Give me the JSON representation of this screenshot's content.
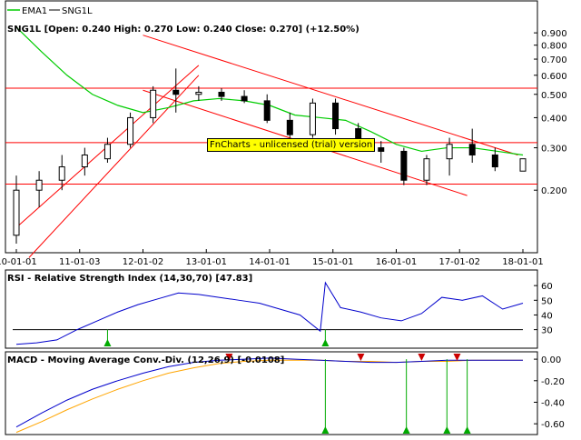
{
  "legend": {
    "ema_label": "EMA1",
    "sym_label": "SNG1L"
  },
  "price_panel": {
    "title": "SNG1L [Open: 0.240  High: 0.270  Low: 0.240  Close: 0.270] (+12.50%)"
  },
  "rsi_panel": {
    "title": "RSI - Relative Strength Index (14,30,70) [47.83]"
  },
  "macd_panel": {
    "title": "MACD - Moving Average Conv.-Div. (12,26,9) [-0.0108]"
  },
  "watermark": "FnCharts - unlicensed (trial) version",
  "colors": {
    "ema": "#00cc00",
    "rsi": "#0000cc",
    "macd": "#0000cc",
    "signal": "#ffa500",
    "trend": "#ff0000",
    "buy": "#00aa00",
    "sell": "#cc0000",
    "grid": "#000000",
    "bg": "#ffffff"
  },
  "chart_data": {
    "type": "candlestick",
    "x_ticks": [
      "10-01-01",
      "11-01-03",
      "12-01-02",
      "13-01-01",
      "14-01-01",
      "15-01-01",
      "16-01-01",
      "17-01-02",
      "18-01-01"
    ],
    "price": {
      "y_scale": "log",
      "ylim": [
        0.11,
        1.0
      ],
      "y_ticks": [
        "0.900",
        "0.800",
        "0.700",
        "0.600",
        "0.500",
        "0.400",
        "0.300",
        "0.200"
      ],
      "y_tick_values": [
        0.9,
        0.8,
        0.7,
        0.6,
        0.5,
        0.4,
        0.3,
        0.2
      ],
      "candles": [
        {
          "t": 0.0,
          "o": 0.13,
          "h": 0.23,
          "l": 0.12,
          "c": 0.2
        },
        {
          "t": 0.045,
          "o": 0.2,
          "h": 0.24,
          "l": 0.17,
          "c": 0.22
        },
        {
          "t": 0.09,
          "o": 0.22,
          "h": 0.28,
          "l": 0.2,
          "c": 0.25
        },
        {
          "t": 0.135,
          "o": 0.25,
          "h": 0.3,
          "l": 0.23,
          "c": 0.28
        },
        {
          "t": 0.18,
          "o": 0.27,
          "h": 0.33,
          "l": 0.26,
          "c": 0.31
        },
        {
          "t": 0.225,
          "o": 0.31,
          "h": 0.42,
          "l": 0.3,
          "c": 0.4
        },
        {
          "t": 0.27,
          "o": 0.4,
          "h": 0.54,
          "l": 0.38,
          "c": 0.52
        },
        {
          "t": 0.315,
          "o": 0.52,
          "h": 0.64,
          "l": 0.42,
          "c": 0.5
        },
        {
          "t": 0.36,
          "o": 0.5,
          "h": 0.54,
          "l": 0.47,
          "c": 0.51
        },
        {
          "t": 0.405,
          "o": 0.51,
          "h": 0.53,
          "l": 0.47,
          "c": 0.49
        },
        {
          "t": 0.45,
          "o": 0.49,
          "h": 0.52,
          "l": 0.46,
          "c": 0.47
        },
        {
          "t": 0.495,
          "o": 0.47,
          "h": 0.5,
          "l": 0.38,
          "c": 0.39
        },
        {
          "t": 0.54,
          "o": 0.39,
          "h": 0.42,
          "l": 0.33,
          "c": 0.34
        },
        {
          "t": 0.585,
          "o": 0.34,
          "h": 0.48,
          "l": 0.33,
          "c": 0.46
        },
        {
          "t": 0.63,
          "o": 0.46,
          "h": 0.48,
          "l": 0.34,
          "c": 0.36
        },
        {
          "t": 0.675,
          "o": 0.36,
          "h": 0.38,
          "l": 0.29,
          "c": 0.3
        },
        {
          "t": 0.72,
          "o": 0.3,
          "h": 0.32,
          "l": 0.26,
          "c": 0.29
        },
        {
          "t": 0.765,
          "o": 0.29,
          "h": 0.3,
          "l": 0.21,
          "c": 0.22
        },
        {
          "t": 0.81,
          "o": 0.22,
          "h": 0.28,
          "l": 0.21,
          "c": 0.27
        },
        {
          "t": 0.855,
          "o": 0.27,
          "h": 0.33,
          "l": 0.23,
          "c": 0.31
        },
        {
          "t": 0.9,
          "o": 0.31,
          "h": 0.36,
          "l": 0.26,
          "c": 0.28
        },
        {
          "t": 0.945,
          "o": 0.28,
          "h": 0.3,
          "l": 0.24,
          "c": 0.25
        },
        {
          "t": 1.0,
          "o": 0.24,
          "h": 0.27,
          "l": 0.24,
          "c": 0.27
        }
      ],
      "ema": [
        [
          0.0,
          0.95
        ],
        [
          0.05,
          0.75
        ],
        [
          0.1,
          0.6
        ],
        [
          0.15,
          0.5
        ],
        [
          0.2,
          0.45
        ],
        [
          0.25,
          0.42
        ],
        [
          0.3,
          0.44
        ],
        [
          0.35,
          0.47
        ],
        [
          0.4,
          0.48
        ],
        [
          0.45,
          0.47
        ],
        [
          0.5,
          0.45
        ],
        [
          0.55,
          0.41
        ],
        [
          0.6,
          0.4
        ],
        [
          0.65,
          0.39
        ],
        [
          0.7,
          0.35
        ],
        [
          0.75,
          0.31
        ],
        [
          0.8,
          0.29
        ],
        [
          0.85,
          0.3
        ],
        [
          0.9,
          0.3
        ],
        [
          0.95,
          0.29
        ],
        [
          1.0,
          0.28
        ]
      ],
      "horizontal_levels": [
        0.53,
        0.315,
        0.212
      ],
      "trend_lines": [
        {
          "t1": 0.0,
          "p1": 0.14,
          "t2": 0.36,
          "p2": 0.66
        },
        {
          "t1": 0.025,
          "p1": 0.105,
          "t2": 0.36,
          "p2": 0.6
        },
        {
          "t1": 0.25,
          "p1": 0.88,
          "t2": 0.99,
          "p2": 0.28
        },
        {
          "t1": 0.25,
          "p1": 0.52,
          "t2": 0.89,
          "p2": 0.19
        }
      ]
    },
    "rsi": {
      "ylim": [
        18,
        70
      ],
      "y_ticks": [
        "60",
        "50",
        "40",
        "30"
      ],
      "y_tick_values": [
        60,
        50,
        40,
        30
      ],
      "level": 30,
      "values": [
        [
          0.0,
          20
        ],
        [
          0.04,
          21
        ],
        [
          0.08,
          23
        ],
        [
          0.12,
          30
        ],
        [
          0.16,
          36
        ],
        [
          0.2,
          42
        ],
        [
          0.24,
          47
        ],
        [
          0.28,
          51
        ],
        [
          0.32,
          55
        ],
        [
          0.36,
          54
        ],
        [
          0.4,
          52
        ],
        [
          0.44,
          50
        ],
        [
          0.48,
          48
        ],
        [
          0.52,
          44
        ],
        [
          0.56,
          40
        ],
        [
          0.6,
          29
        ],
        [
          0.61,
          62
        ],
        [
          0.64,
          45
        ],
        [
          0.68,
          42
        ],
        [
          0.72,
          38
        ],
        [
          0.76,
          36
        ],
        [
          0.8,
          41
        ],
        [
          0.84,
          52
        ],
        [
          0.88,
          50
        ],
        [
          0.92,
          53
        ],
        [
          0.96,
          44
        ],
        [
          1.0,
          48
        ]
      ],
      "buy_signals": [
        0.18,
        0.61
      ]
    },
    "macd": {
      "ylim": [
        -0.7,
        0.06
      ],
      "y_ticks": [
        "0.00",
        "-0.20",
        "-0.40",
        "-0.60"
      ],
      "y_tick_values": [
        0.0,
        -0.2,
        -0.4,
        -0.6
      ],
      "macd": [
        [
          0.0,
          -0.63
        ],
        [
          0.05,
          -0.5
        ],
        [
          0.1,
          -0.38
        ],
        [
          0.15,
          -0.28
        ],
        [
          0.2,
          -0.2
        ],
        [
          0.25,
          -0.13
        ],
        [
          0.3,
          -0.07
        ],
        [
          0.35,
          -0.03
        ],
        [
          0.4,
          -0.01
        ],
        [
          0.45,
          0.0
        ],
        [
          0.5,
          0.01
        ],
        [
          0.55,
          0.0
        ],
        [
          0.6,
          -0.01
        ],
        [
          0.65,
          -0.02
        ],
        [
          0.7,
          -0.03
        ],
        [
          0.75,
          -0.03
        ],
        [
          0.8,
          -0.02
        ],
        [
          0.85,
          -0.01
        ],
        [
          0.9,
          -0.01
        ],
        [
          0.95,
          -0.01
        ],
        [
          1.0,
          -0.01
        ]
      ],
      "signal": [
        [
          0.0,
          -0.68
        ],
        [
          0.05,
          -0.58
        ],
        [
          0.1,
          -0.47
        ],
        [
          0.15,
          -0.37
        ],
        [
          0.2,
          -0.28
        ],
        [
          0.25,
          -0.2
        ],
        [
          0.3,
          -0.13
        ],
        [
          0.35,
          -0.08
        ],
        [
          0.4,
          -0.04
        ],
        [
          0.45,
          -0.02
        ],
        [
          0.5,
          -0.01
        ],
        [
          0.55,
          -0.01
        ],
        [
          0.6,
          -0.01
        ],
        [
          0.65,
          -0.02
        ],
        [
          0.7,
          -0.02
        ],
        [
          0.75,
          -0.03
        ],
        [
          0.8,
          -0.02
        ],
        [
          0.85,
          -0.02
        ],
        [
          0.9,
          -0.01
        ],
        [
          0.95,
          -0.01
        ],
        [
          1.0,
          -0.01
        ]
      ],
      "buy_signals": [
        0.61,
        0.77,
        0.85,
        0.89
      ],
      "sell_signals": [
        0.42,
        0.68,
        0.8,
        0.87
      ]
    }
  }
}
